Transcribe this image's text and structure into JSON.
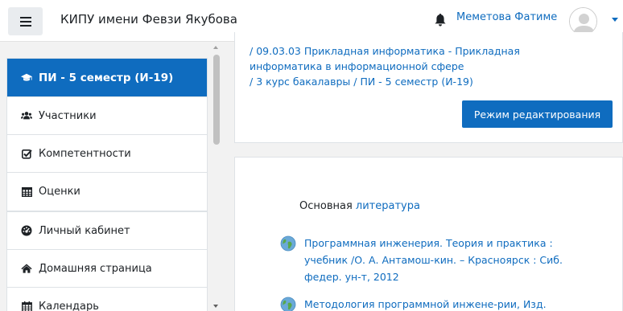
{
  "navbar": {
    "menu_icon": "hamburger-icon",
    "site_name": "КИПУ имени Февзи Якубова",
    "notifications_icon": "bell-icon",
    "user_name": "Меметова Фатиме"
  },
  "sidebar": {
    "course_item": "ПИ - 5 семестр (И-19)",
    "items": [
      {
        "label": "Участники",
        "icon": "users-icon"
      },
      {
        "label": "Компетентности",
        "icon": "checkbox-icon"
      },
      {
        "label": "Оценки",
        "icon": "table-icon"
      }
    ],
    "items2": [
      {
        "label": "Личный кабинет",
        "icon": "dashboard-icon"
      },
      {
        "label": "Домашняя страница",
        "icon": "home-icon"
      },
      {
        "label": "Календарь",
        "icon": "calendar-icon"
      }
    ]
  },
  "header": {
    "breadcrumb": [
      "09.03.03 Прикладная информатика - Прикладная информатика в информационной сфере",
      "3 курс бакалавры",
      "ПИ - 5 семестр (И-19)"
    ],
    "breadcrumb_separator": "/",
    "edit_button": "Режим редактирования"
  },
  "content": {
    "lit_prefix": "Основная",
    "lit_link": "литература",
    "resources": [
      "Программная инженерия. Теория и практика : учебник /О. А. Антамош-кин. – Красноярск : Сиб. федер. ун-т, 2012",
      "Методология программной инжене-рии, Изд."
    ]
  },
  "colors": {
    "primary": "#0f6cbf",
    "background": "#f2f2f2"
  }
}
